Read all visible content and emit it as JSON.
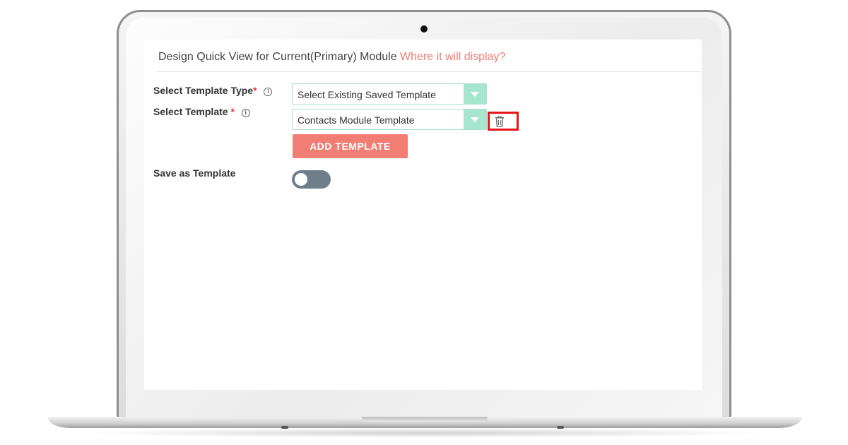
{
  "header": {
    "title": "Design Quick View for Current(Primary) Module",
    "help_link": "Where it will display?"
  },
  "form": {
    "template_type": {
      "label": "Select Template Type",
      "required_mark": "*",
      "info_icon": "info-icon",
      "selected_value": "Select Existing Saved Template"
    },
    "template": {
      "label": "Select Template ",
      "required_mark": "*",
      "info_icon": "info-icon",
      "selected_value": "Contacts Module Template",
      "delete_icon": "trash-icon"
    },
    "add_button_label": "ADD TEMPLATE",
    "save_as_template": {
      "label": "Save as Template",
      "enabled": false
    }
  },
  "colors": {
    "accent_link": "#f07a74",
    "button": "#f07e74",
    "select_caret": "#a6e6cf",
    "highlight_box": "#e8141a",
    "toggle_off": "#6f7f8a"
  }
}
